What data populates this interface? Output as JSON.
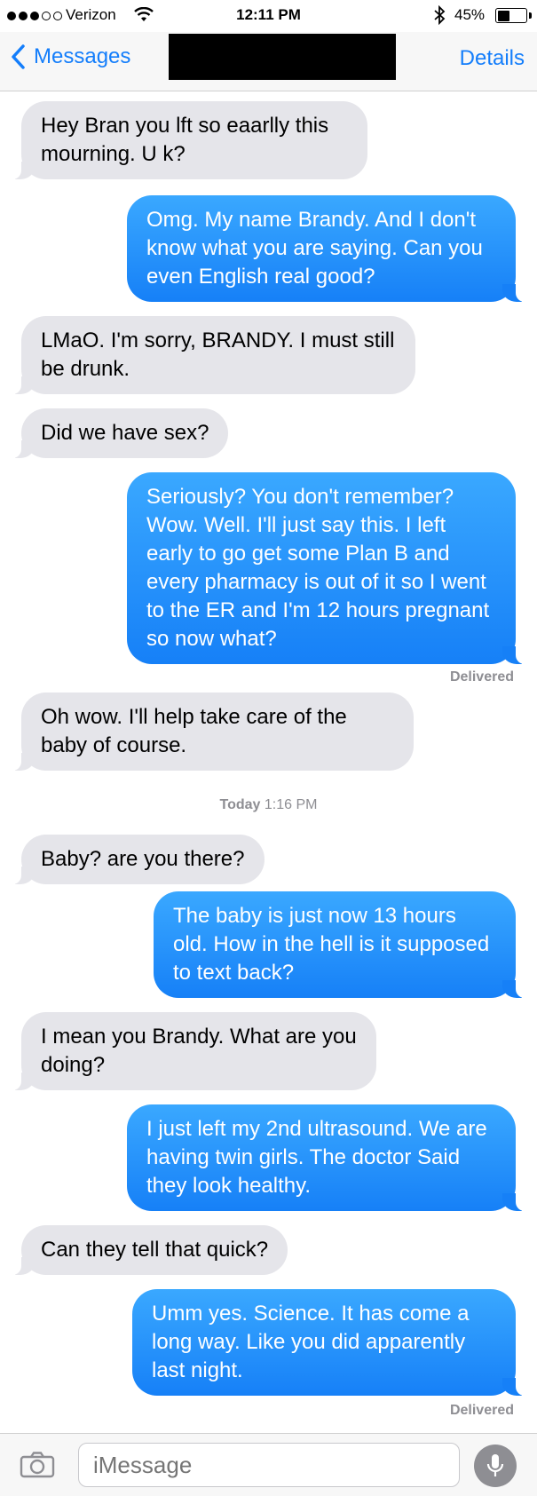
{
  "status_bar": {
    "carrier": "Verizon",
    "time": "12:11 PM",
    "battery_percent": "45%",
    "battery_level": 0.45,
    "signal_bars_filled": 3,
    "signal_bars_total": 5
  },
  "nav": {
    "back_label": "Messages",
    "details_label": "Details"
  },
  "messages": [
    {
      "direction": "in",
      "text": "Hey Bran you lft so eaarlly this mourning. U k?"
    },
    {
      "direction": "out",
      "text": "Omg. My name Brandy. And I don't know what you are saying. Can you even English real good?"
    },
    {
      "direction": "in",
      "text": "LMaO. I'm sorry, BRANDY. I must still be drunk."
    },
    {
      "direction": "in",
      "text": "Did we have sex?"
    },
    {
      "direction": "out",
      "text": "Seriously? You don't remember? Wow. Well. I'll just say this. I left early to go get some Plan B and every pharmacy is out of it so I went to the ER and I'm 12 hours pregnant so now what?"
    },
    {
      "direction": "status",
      "text": "Delivered"
    },
    {
      "direction": "in",
      "text": "Oh wow. I'll help take care of the baby of course."
    },
    {
      "direction": "timestamp",
      "day": "Today",
      "time": "1:16 PM"
    },
    {
      "direction": "in",
      "text": "Baby? are you there?"
    },
    {
      "direction": "out",
      "text": "The baby is just now 13 hours old. How in the hell is it supposed to text back?"
    },
    {
      "direction": "in",
      "text": "I mean you Brandy. What are you doing?"
    },
    {
      "direction": "out",
      "text": "I just left my 2nd ultrasound. We are having twin girls. The doctor Said they look healthy."
    },
    {
      "direction": "in",
      "text": "Can they tell that quick?"
    },
    {
      "direction": "out",
      "text": "Umm yes. Science. It has come a long way. Like you did apparently last night."
    },
    {
      "direction": "status",
      "text": "Delivered"
    }
  ],
  "input": {
    "placeholder": "iMessage"
  },
  "icons": [
    "wifi-icon",
    "bluetooth-icon",
    "battery-icon",
    "chevron-left-icon",
    "camera-icon",
    "microphone-icon"
  ],
  "colors": {
    "accent": "#147efb",
    "outgoing_bubble": "#1b8bfa",
    "incoming_bubble": "#e5e5ea",
    "meta_text": "#8e8e93"
  }
}
